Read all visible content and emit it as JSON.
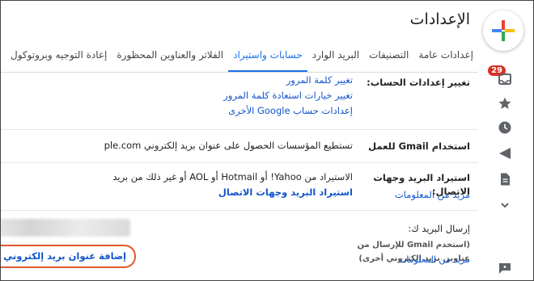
{
  "title": "الإعدادات",
  "tabs": [
    {
      "label": "إعدادات عامة"
    },
    {
      "label": "التصنيفات"
    },
    {
      "label": "البريد الوارد"
    },
    {
      "label": "حسابات واستيراد"
    },
    {
      "label": "الفلاتر والعناوين المحظورة"
    },
    {
      "label": "إعادة التوجيه وبروتوكول"
    }
  ],
  "rows": {
    "account": {
      "label": "تغيير إعدادات الحساب:",
      "links": [
        "تغيير كلمة المرور",
        "تغيير خيارات استعادة كلمة المرور",
        "إعدادات حساب Google الأخرى"
      ]
    },
    "work": {
      "label": "استخدام Gmail للعمل",
      "text": "تستطيع المؤسسات الحصول على عنوان بريد إلكتروني ple.com"
    },
    "import": {
      "label": "استيراد البريد وجهات الاتصال:",
      "more": "مزيد من المعلومات",
      "text": "الاستيراد من Yahoo!‏ أو Hotmail أو AOL أو غير ذلك من بريد",
      "action": "استيراد البريد وجهات الاتصال"
    },
    "send": {
      "label": "إرسال البريد ك:",
      "desc": "(استخدم Gmail للإرسال من عناوين بريد إلكتروني أخرى)",
      "more": "مزيد من المعلومات",
      "add": "إضافة عنوان بريد إلكتروني آخر"
    }
  },
  "rail": {
    "badge": "29",
    "icons": [
      "inbox-icon",
      "star-icon",
      "clock-icon",
      "send-icon",
      "draft-icon",
      "chevron-down-icon",
      "chat-icon"
    ]
  }
}
